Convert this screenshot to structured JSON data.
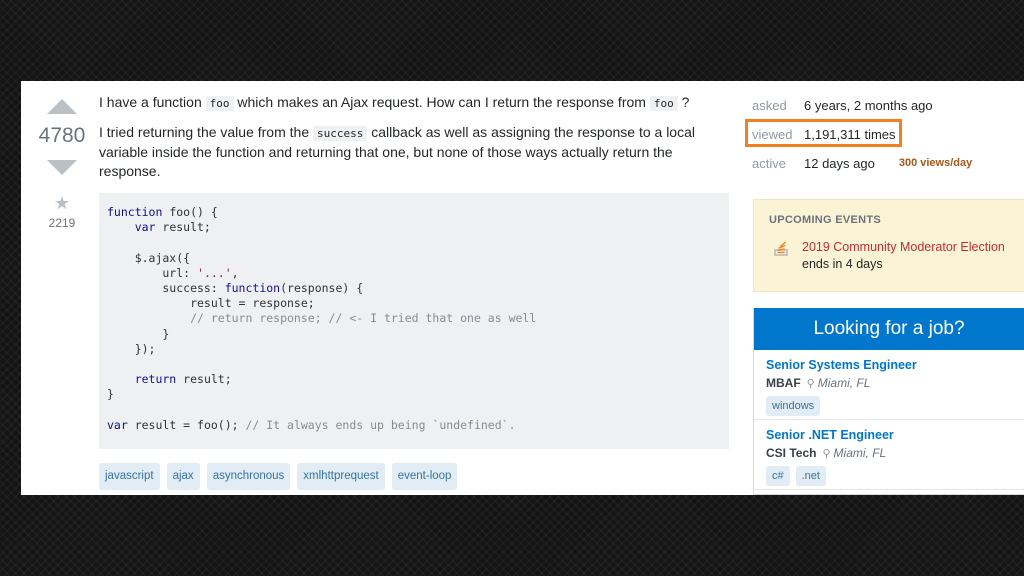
{
  "votes": {
    "count": "4780",
    "favorites": "2219"
  },
  "question": {
    "p1_before": "I have a function ",
    "p1_code1": "foo",
    "p1_middle": " which makes an Ajax request. How can I return the response from ",
    "p1_code2": "foo",
    "p1_after": " ?",
    "p2_before": "I tried returning the value from the ",
    "p2_code": "success",
    "p2_after": " callback as well as assigning the response to a local variable inside the function and returning that one, but none of those ways actually return the response.",
    "code": {
      "l1a": "function",
      "l1b": " foo() {",
      "l2a": "    var",
      "l2b": " result;",
      "l4": "    $.ajax({",
      "l5a": "        url: ",
      "l5b": "'...'",
      "l5c": ",",
      "l6a": "        success: ",
      "l6b": "function",
      "l6c": "(response) {",
      "l7": "            result = response;",
      "l8": "            // return response; // <- I tried that one as well",
      "l9": "        }",
      "l10": "    });",
      "l12a": "    return",
      "l12b": " result;",
      "l13": "}",
      "l15a": "var",
      "l15b": " result = foo(); ",
      "l15c": "// It always ends up being `undefined`."
    },
    "tags": [
      "javascript",
      "ajax",
      "asynchronous",
      "xmlhttprequest",
      "event-loop"
    ]
  },
  "stats": {
    "asked_label": "asked",
    "asked_value": "6 years, 2 months ago",
    "viewed_label": "viewed",
    "viewed_value": "1,191,311 times",
    "active_label": "active",
    "active_value": "12 days ago",
    "views_per_day": "300 views/day",
    "highlight_color": "#f48024"
  },
  "events": {
    "title": "UPCOMING EVENTS",
    "icon": "stack-overflow-icon",
    "name": "2019 Community Moderator Election",
    "sub": "ends in 4 days"
  },
  "jobs": {
    "header": "Looking for a job?",
    "items": [
      {
        "title": "Senior Systems Engineer",
        "company": "MBAF",
        "location": "Miami, FL",
        "tags": [
          "windows"
        ]
      },
      {
        "title": "Senior .NET Engineer",
        "company": "CSI Tech",
        "location": "Miami, FL",
        "tags": [
          "c#",
          ".net"
        ]
      }
    ]
  },
  "colors": {
    "accent": "#f48024",
    "link": "#0077cc",
    "tag_bg": "#e1ecf4"
  }
}
